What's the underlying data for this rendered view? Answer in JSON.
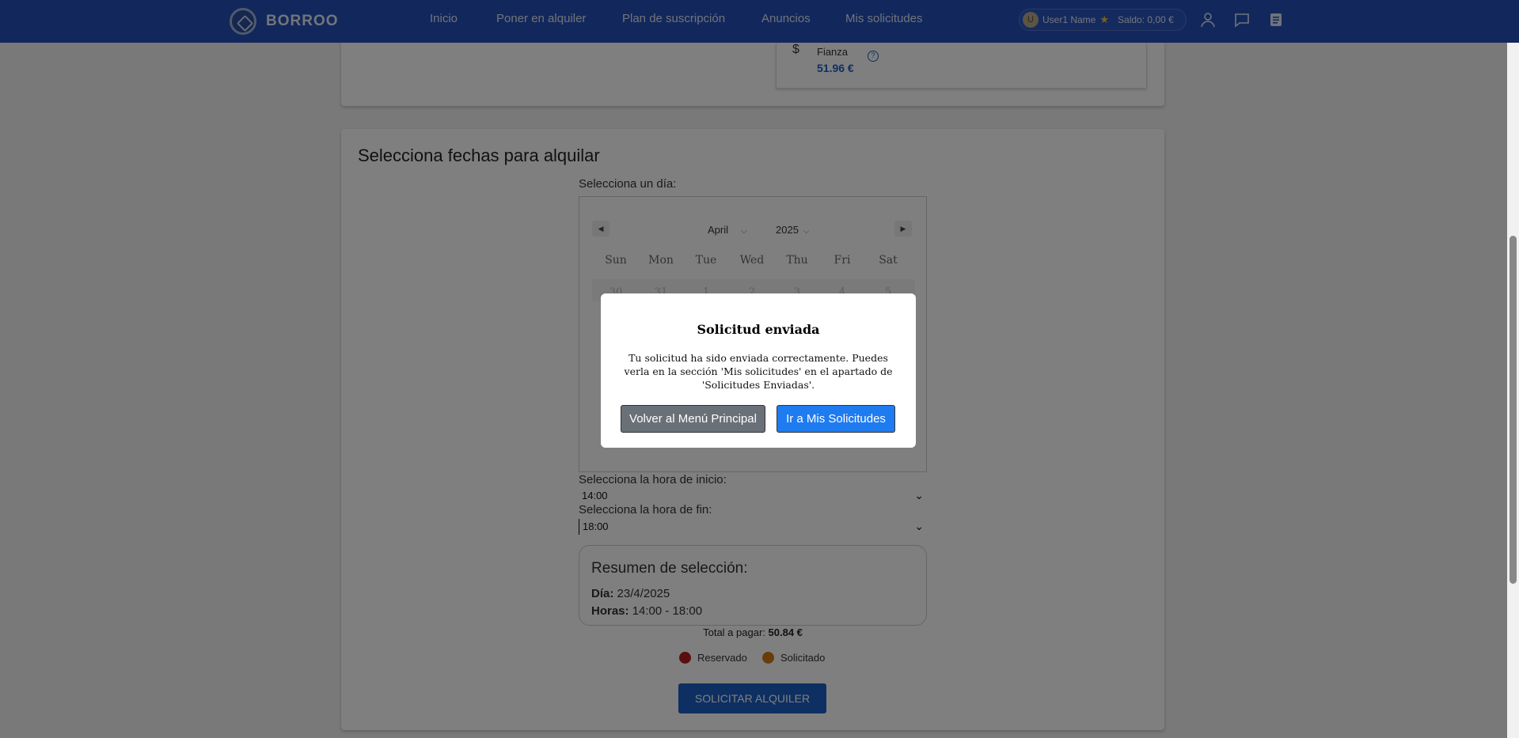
{
  "header": {
    "brand": "BORROO",
    "nav": [
      "Inicio",
      "Poner en alquiler",
      "Plan de suscripción",
      "Anuncios",
      "Mis solicitudes"
    ],
    "user": {
      "initial": "U",
      "name": "User1 Name",
      "balance": "Saldo: 0,00 €"
    }
  },
  "deposit": {
    "label": "Fianza",
    "amount": "51.96 €"
  },
  "booking": {
    "title": "Selecciona fechas para alquilar",
    "day_label": "Selecciona un día:",
    "calendar": {
      "month": "April",
      "year": "2025",
      "weekdays": [
        "Sun",
        "Mon",
        "Tue",
        "Wed",
        "Thu",
        "Fri",
        "Sat"
      ],
      "first_row": [
        "30",
        "31",
        "1",
        "2",
        "3",
        "4",
        "5"
      ]
    },
    "start_label": "Selecciona la hora de inicio:",
    "start_value": "14:00",
    "end_label": "Selecciona la hora de fin:",
    "end_value": "18:00",
    "summary": {
      "title": "Resumen de selección:",
      "day_key": "Día:",
      "day_value": "23/4/2025",
      "hours_key": "Horas:",
      "hours_value": "14:00 - 18:00"
    },
    "total_label": "Total a pagar:",
    "total_value": "50.84 €",
    "legend": [
      {
        "label": "Reservado",
        "color": "#b51f1f"
      },
      {
        "label": "Solicitado",
        "color": "#d07a12"
      }
    ],
    "submit": "SOLICITAR ALQUILER"
  },
  "dialog": {
    "title": "Solicitud enviada",
    "message": "Tu solicitud ha sido enviada correctamente. Puedes verla en la sección 'Mis solicitudes' en el apartado de 'Solicitudes Enviadas'.",
    "back_button": "Volver al Menú Principal",
    "go_button": "Ir a Mis Solicitudes"
  },
  "colors": {
    "header": "#2550b8",
    "primary": "#1c5fc2",
    "dialog_primary": "#1e7bf0",
    "dialog_secondary": "#6a7078"
  }
}
